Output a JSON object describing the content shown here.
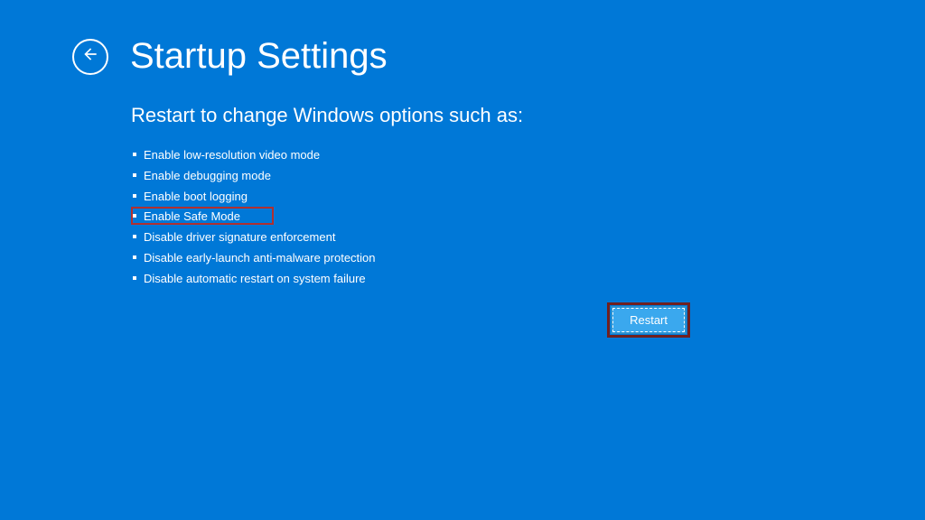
{
  "header": {
    "title": "Startup Settings"
  },
  "content": {
    "subtitle": "Restart to change Windows options such as:",
    "options": [
      "Enable low-resolution video mode",
      "Enable debugging mode",
      "Enable boot logging",
      "Enable Safe Mode",
      "Disable driver signature enforcement",
      "Disable early-launch anti-malware protection",
      "Disable automatic restart on system failure"
    ]
  },
  "actions": {
    "restart_label": "Restart"
  },
  "colors": {
    "background": "#0078d7",
    "text": "#ffffff",
    "highlight_border": "#b03030",
    "button_bg": "#3aa8ee"
  }
}
